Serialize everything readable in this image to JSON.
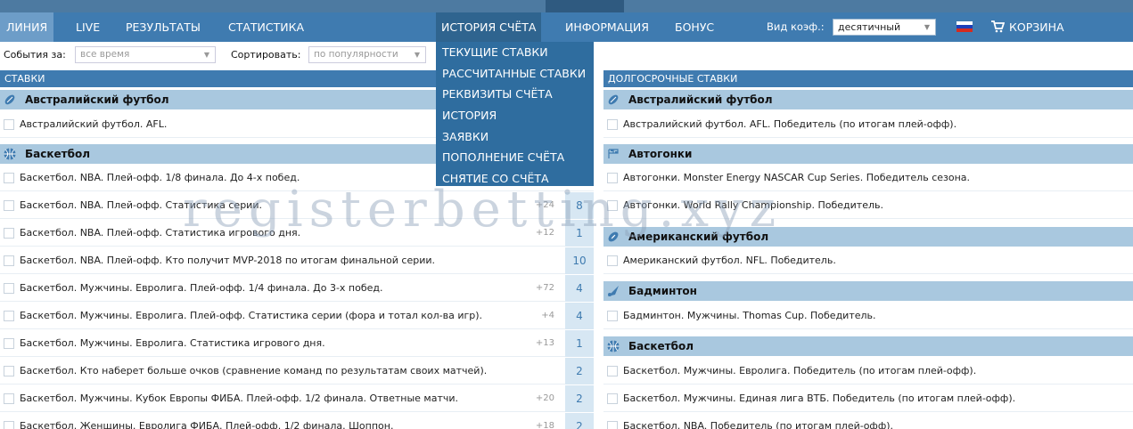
{
  "nav": {
    "items": [
      "ЛИНИЯ",
      "LIVE",
      "РЕЗУЛЬТАТЫ",
      "СТАТИСТИКА",
      "ИСТОРИЯ СЧЁТА",
      "ИНФОРМАЦИЯ",
      "БОНУС"
    ],
    "odds_label": "Вид коэф.:",
    "odds_value": "десятичный",
    "cart_label": "КОРЗИНА"
  },
  "account_menu": {
    "items": [
      "ТЕКУЩИЕ СТАВКИ",
      "РАССЧИТАННЫЕ СТАВКИ",
      "РЕКВИЗИТЫ СЧЁТА",
      "ИСТОРИЯ",
      "ЗАЯВКИ",
      "ПОПОЛНЕНИЕ СЧЁТА",
      "СНЯТИЕ СО СЧЁТА"
    ]
  },
  "filters": {
    "events_label": "События за:",
    "events_value": "все время",
    "sort_label": "Сортировать:",
    "sort_value": "по популярности"
  },
  "left": {
    "header": "СТАВКИ",
    "categories": [
      {
        "name": "Австралийский футбол",
        "icon": "australian-football-icon",
        "rows": [
          {
            "text": "Австралийский футбол. AFL.",
            "plus": "",
            "count": ""
          }
        ]
      },
      {
        "name": "Баскетбол",
        "icon": "basketball-icon",
        "rows": [
          {
            "text": "Баскетбол. NBA. Плей-офф. 1/8 финала. До 4-х побед.",
            "plus": "",
            "count": ""
          },
          {
            "text": "Баскетбол. NBA. Плей-офф. Статистика серии.",
            "plus": "+24",
            "count": "8"
          },
          {
            "text": "Баскетбол. NBA. Плей-офф. Статистика игрового дня.",
            "plus": "+12",
            "count": "1"
          },
          {
            "text": "Баскетбол. NBA. Плей-офф. Кто получит MVP-2018 по итогам финальной серии.",
            "plus": "",
            "count": "10"
          },
          {
            "text": "Баскетбол. Мужчины. Евролига. Плей-офф. 1/4 финала. До 3-х побед.",
            "plus": "+72",
            "count": "4"
          },
          {
            "text": "Баскетбол. Мужчины. Евролига. Плей-офф. Статистика серии (фора и тотал кол-ва игр).",
            "plus": "+4",
            "count": "4"
          },
          {
            "text": "Баскетбол. Мужчины. Евролига. Статистика игрового дня.",
            "plus": "+13",
            "count": "1"
          },
          {
            "text": "Баскетбол. Кто наберет больше очков (сравнение команд по результатам своих матчей).",
            "plus": "",
            "count": "2"
          },
          {
            "text": "Баскетбол. Мужчины. Кубок Европы ФИБА. Плей-офф. 1/2 финала. Ответные матчи.",
            "plus": "+20",
            "count": "2"
          },
          {
            "text": "Баскетбол. Женщины. Евролига ФИБА. Плей-офф. 1/2 финала. Шоппон.",
            "plus": "+18",
            "count": "2"
          }
        ]
      }
    ]
  },
  "right": {
    "header": "ДОЛГОСРОЧНЫЕ СТАВКИ",
    "categories": [
      {
        "name": "Австралийский футбол",
        "icon": "australian-football-icon",
        "rows": [
          "Австралийский футбол. AFL. Победитель (по итогам плей-офф)."
        ]
      },
      {
        "name": "Автогонки",
        "icon": "racing-icon",
        "rows": [
          "Автогонки. Monster Energy NASCAR Cup Series. Победитель сезона.",
          "Автогонки. World Rally Championship. Победитель."
        ]
      },
      {
        "name": "Американский футбол",
        "icon": "american-football-icon",
        "rows": [
          "Американский футбол. NFL. Победитель."
        ]
      },
      {
        "name": "Бадминтон",
        "icon": "badminton-icon",
        "rows": [
          "Бадминтон. Мужчины. Thomas Cup. Победитель."
        ]
      },
      {
        "name": "Баскетбол",
        "icon": "basketball-icon",
        "rows": [
          "Баскетбол. Мужчины. Евролига. Победитель (по итогам плей-офф).",
          "Баскетбол. Мужчины. Единая лига ВТБ. Победитель (по итогам плей-офф).",
          "Баскетбол. NBA. Победитель (по итогам плей-офф)."
        ]
      }
    ]
  },
  "watermark": "registerbetting.xyz",
  "colors": {
    "nav": "#3f7bb0",
    "category": "#a9c8df",
    "dropdown": "#2f6d9f",
    "count_bg": "#d7e7f3"
  }
}
